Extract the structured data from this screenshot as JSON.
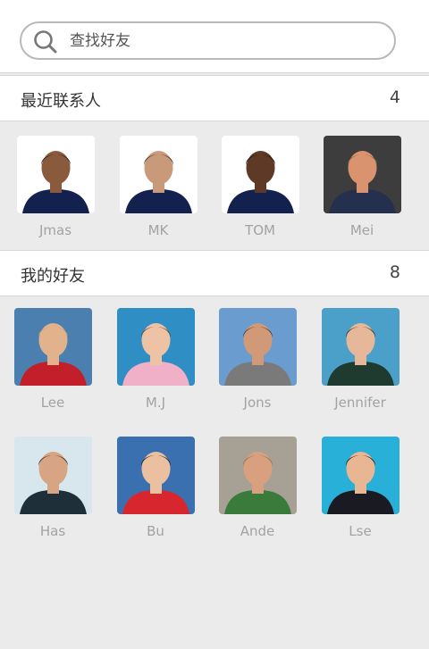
{
  "search": {
    "placeholder": "查找好友"
  },
  "recent": {
    "title": "最近联系人",
    "count": "4",
    "contacts": [
      {
        "name": "Jmas",
        "bg": "#ffffff",
        "skin": "#8a5a3c",
        "hair": "#1e1410",
        "shirt": "#12214d"
      },
      {
        "name": "MK",
        "bg": "#ffffff",
        "skin": "#c99a7a",
        "hair": "#3a2818",
        "shirt": "#12214d"
      },
      {
        "name": "TOM",
        "bg": "#ffffff",
        "skin": "#5e3a26",
        "hair": "#120c08",
        "shirt": "#12214d"
      },
      {
        "name": "Mei",
        "bg": "#3d3d3d",
        "skin": "#d9936f",
        "hair": "#8a6a3a",
        "shirt": "#24304d"
      }
    ]
  },
  "friends": {
    "title": "我的好友",
    "count": "8",
    "contacts": [
      {
        "name": "Lee",
        "bg": "#4a7fb0",
        "skin": "#e2b28d",
        "hair": "#c9a86a",
        "shirt": "#c21f2a"
      },
      {
        "name": "M.J",
        "bg": "#2f8fc4",
        "skin": "#eec2a4",
        "hair": "#5c3b22",
        "shirt": "#f0b0c8"
      },
      {
        "name": "Jons",
        "bg": "#6a9ccf",
        "skin": "#d09a78",
        "hair": "#4b2f1e",
        "shirt": "#7a7a7a"
      },
      {
        "name": "Jennifer",
        "bg": "#4aa0c8",
        "skin": "#e6b899",
        "hair": "#3a2418",
        "shirt": "#1f3a2f"
      },
      {
        "name": "Has",
        "bg": "#d8e6ee",
        "skin": "#d8a584",
        "hair": "#2a1a12",
        "shirt": "#1f2f3a"
      },
      {
        "name": "Bu",
        "bg": "#3a6fb0",
        "skin": "#eac0a0",
        "hair": "#1a120c",
        "shirt": "#d8262f"
      },
      {
        "name": "Ande",
        "bg": "#a7a095",
        "skin": "#d8a07e",
        "hair": "#9a6a3a",
        "shirt": "#3a7a3a"
      },
      {
        "name": "Lse",
        "bg": "#28b0d8",
        "skin": "#e8b692",
        "hair": "#14100c",
        "shirt": "#1a1a22"
      }
    ]
  }
}
